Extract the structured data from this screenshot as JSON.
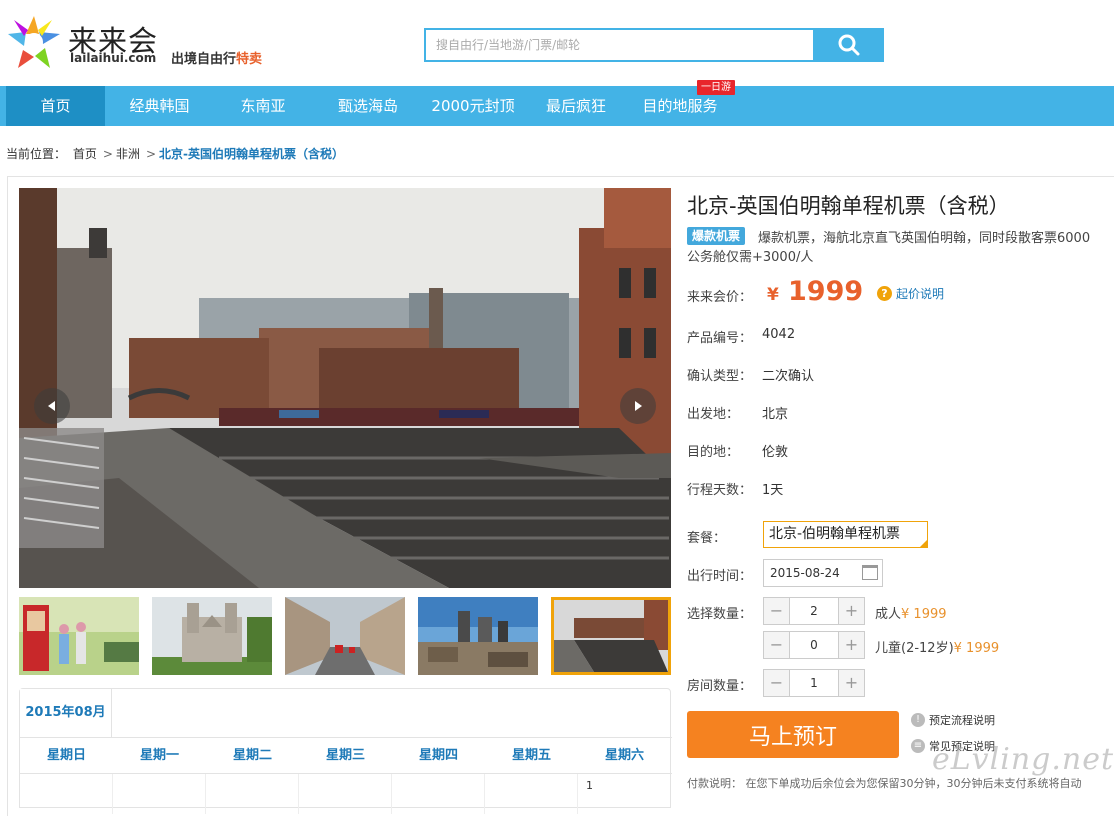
{
  "header": {
    "logo_name": "来来会",
    "logo_domain": "lailaihui.com",
    "slogan_main": "出境自由行",
    "slogan_hot": "特卖",
    "search_placeholder": "搜自由行/当地游/门票/邮轮"
  },
  "nav": {
    "items": [
      "首页",
      "经典韩国",
      "东南亚",
      "甄选海岛",
      "2000元封顶",
      "最后疯狂",
      "目的地服务"
    ],
    "tag": "一日游"
  },
  "breadcrumb": {
    "prefix": "当前位置：",
    "items": [
      "首页",
      "非洲"
    ],
    "current": "北京-英国伯明翰单程机票（含税）",
    "sep": ">"
  },
  "product": {
    "title": "北京-英国伯明翰单程机票（含税）",
    "badge": "爆款机票",
    "desc_line1": "爆款机票，海航北京直飞英国伯明翰，同时段散客票6000",
    "desc_line2": "公务舱仅需+3000/人",
    "price_label": "来来会价：",
    "price_symbol": "¥",
    "price": "1999",
    "price_help": "起价说明",
    "fields": [
      {
        "label": "产品编号：",
        "value": "4042"
      },
      {
        "label": "确认类型：",
        "value": "二次确认"
      },
      {
        "label": "出发地：",
        "value": "北京"
      },
      {
        "label": "目的地：",
        "value": "伦敦"
      },
      {
        "label": "行程天数：",
        "value": "1天"
      }
    ],
    "package_label": "套餐：",
    "package_value": "北京-伯明翰单程机票",
    "date_label": "出行时间：",
    "date_value": "2015-08-24",
    "quantity_label": "选择数量：",
    "adult": {
      "count": "2",
      "label": "成人",
      "price": "¥ 1999"
    },
    "child": {
      "count": "0",
      "label": "儿童(2-12岁)",
      "price": "¥ 1999"
    },
    "room_label": "房间数量：",
    "room_count": "1",
    "minus": "−",
    "plus": "+",
    "book_button": "马上预订",
    "links": [
      "预定流程说明",
      "常见预定说明"
    ],
    "pay_note": "付款说明：  在您下单成功后余位会为您保留30分钟，30分钟后未支付系统将自动"
  },
  "calendar": {
    "month": "2015年08月",
    "weekdays": [
      "星期日",
      "星期一",
      "星期二",
      "星期三",
      "星期四",
      "星期五",
      "星期六"
    ],
    "first_day": "1"
  },
  "watermark": "eLvling.net",
  "colors": {
    "brand_blue": "#43b3e6",
    "active_nav": "#1e8fc5",
    "price_orange": "#e8612c",
    "book_orange": "#f58220",
    "link_blue": "#1e7ab8"
  }
}
